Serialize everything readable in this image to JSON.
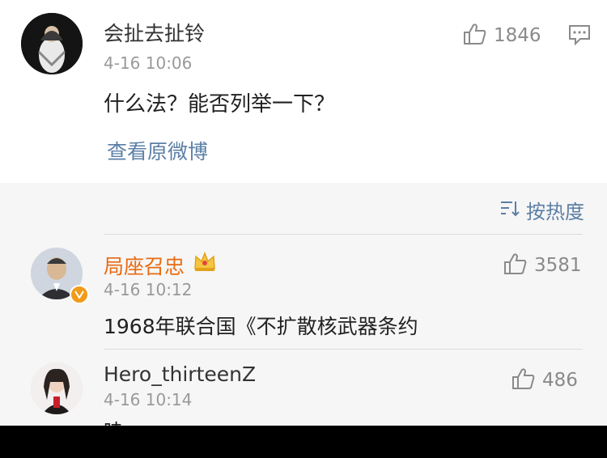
{
  "post_comment": {
    "username": "会扯去扯铃",
    "time": "4-16 10:06",
    "text": "什么法？能否列举一下？",
    "like_count": "1846",
    "view_original_link": "查看原微博"
  },
  "comments_section": {
    "sort_label": "按热度",
    "comments": [
      {
        "username": "局座召忠",
        "time": "4-16 10:12",
        "text": "1968年联合国《不扩散核武器条约",
        "like_count": "3581",
        "name_color": "#e86b12"
      },
      {
        "username": "Hero_thirteenZ",
        "time": "4-16 10:14",
        "text": "哇",
        "like_count": "486"
      }
    ]
  },
  "colors": {
    "link_blue": "#5b7fa6",
    "vip_orange": "#e86b12",
    "gray_text": "#999999",
    "background_gray": "#f6f6f6"
  }
}
